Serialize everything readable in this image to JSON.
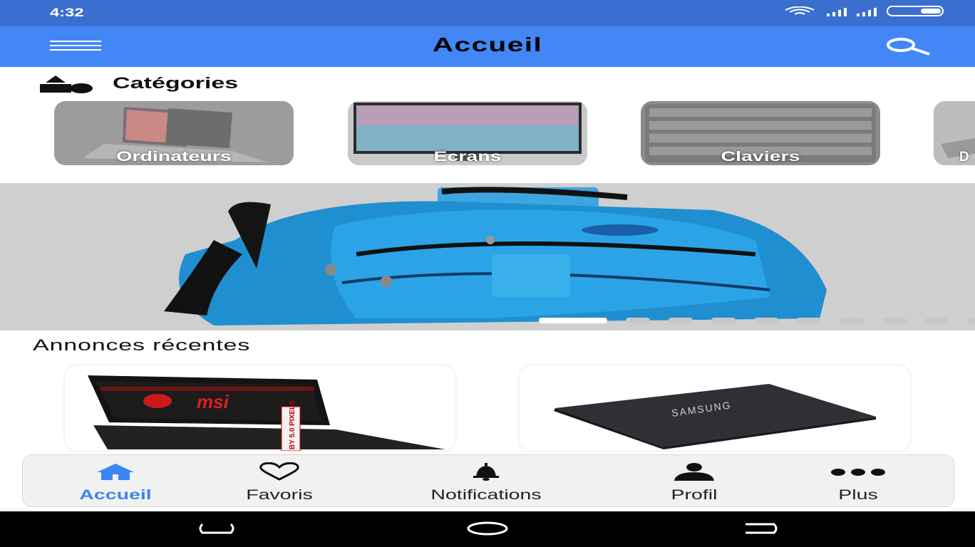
{
  "status_bar": {
    "time": "4:32"
  },
  "app_bar": {
    "title": "Accueil"
  },
  "categories": {
    "title": "Catégories",
    "items": [
      {
        "label": "Ordinateurs"
      },
      {
        "label": "Ecrans"
      },
      {
        "label": "Claviers"
      },
      {
        "label": "D"
      }
    ]
  },
  "banner": {
    "dot_count": 10,
    "active_index": 0
  },
  "recent": {
    "title": "Annonces récentes",
    "ads": [
      {
        "brand": "msi",
        "sticker": "BY 5.0 PIXELS"
      },
      {
        "brand": "SAMSUNG"
      }
    ]
  },
  "bottom_nav": {
    "items": [
      {
        "label": "Accueil",
        "icon": "home-icon",
        "active": true
      },
      {
        "label": "Favoris",
        "icon": "heart-icon"
      },
      {
        "label": "Notifications",
        "icon": "bell-icon"
      },
      {
        "label": "Profil",
        "icon": "person-icon"
      },
      {
        "label": "Plus",
        "icon": "more-icon"
      }
    ]
  },
  "colors": {
    "status_bar": "#3a6fd0",
    "app_bar": "#4287f5",
    "accent": "#3a86f2"
  }
}
